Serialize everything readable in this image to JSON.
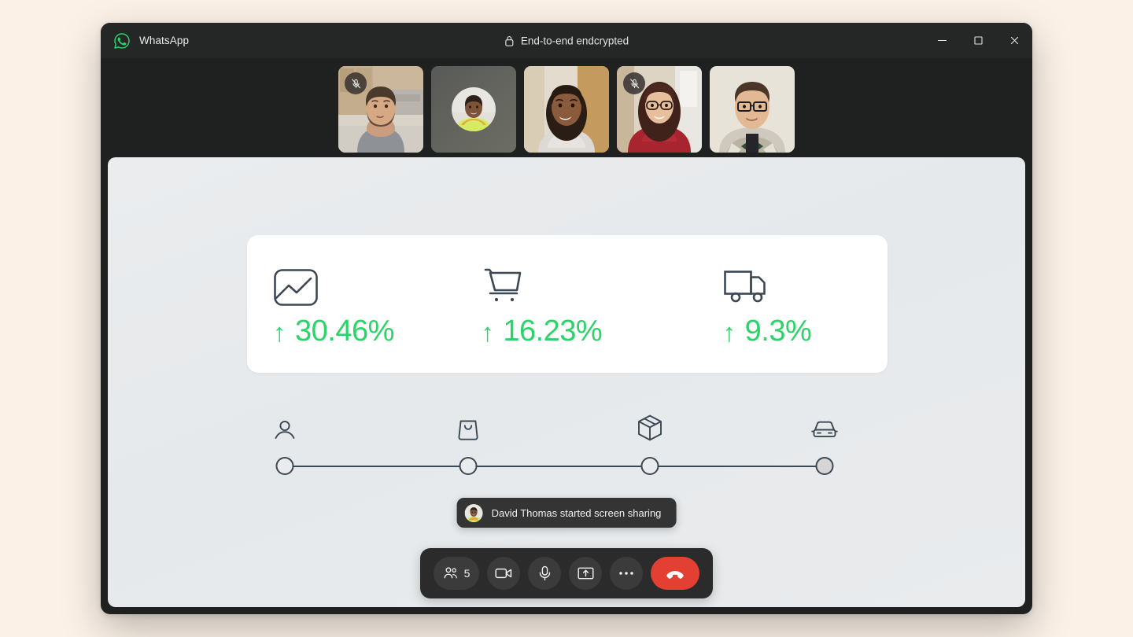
{
  "window": {
    "app_name": "WhatsApp",
    "logo_icon": "whatsapp-logo",
    "encryption_label": "End-to-end endcrypted",
    "lock_icon": "lock-icon",
    "controls": [
      {
        "name": "minimize",
        "icon": "minimize-icon"
      },
      {
        "name": "maximize",
        "icon": "maximize-icon"
      },
      {
        "name": "close",
        "icon": "close-icon"
      }
    ]
  },
  "call": {
    "participants": [
      {
        "name": "participant-1",
        "muted": true,
        "camera_on": true,
        "mute_icon": "mic-off-icon"
      },
      {
        "name": "participant-2",
        "muted": false,
        "camera_on": false,
        "mute_icon": ""
      },
      {
        "name": "participant-3",
        "muted": false,
        "camera_on": true,
        "mute_icon": ""
      },
      {
        "name": "participant-4",
        "muted": true,
        "camera_on": true,
        "mute_icon": "mic-off-icon"
      },
      {
        "name": "participant-5",
        "muted": false,
        "camera_on": true,
        "mute_icon": ""
      }
    ]
  },
  "shared_screen": {
    "metrics": [
      {
        "icon": "image-chart-icon",
        "arrow": "↑",
        "value": "30.46%"
      },
      {
        "icon": "shopping-cart-icon",
        "arrow": "↑",
        "value": "16.23%"
      },
      {
        "icon": "delivery-truck-icon",
        "arrow": "↑",
        "value": "9.3%"
      }
    ],
    "journey": {
      "steps": [
        {
          "icon": "user-icon",
          "filled": false,
          "position": 0
        },
        {
          "icon": "shopping-bag-icon",
          "filled": false,
          "position": 33.3
        },
        {
          "icon": "package-box-icon",
          "filled": false,
          "position": 66.6
        },
        {
          "icon": "car-icon",
          "filled": true,
          "position": 100
        }
      ]
    }
  },
  "toast": {
    "avatar_icon": "user-avatar",
    "message": "David Thomas started screen sharing"
  },
  "controls": {
    "participants": {
      "icon": "people-icon",
      "count": "5"
    },
    "camera": {
      "icon": "video-camera-icon"
    },
    "microphone": {
      "icon": "microphone-icon"
    },
    "share_screen": {
      "icon": "share-screen-icon"
    },
    "more": {
      "icon": "more-dots-icon"
    },
    "end_call": {
      "icon": "end-call-icon"
    }
  },
  "colors": {
    "page_background": "#fbf1e7",
    "window_background": "#1f2020",
    "titlebar": "#252626",
    "shared_screen": "#e8eaec",
    "accent_green": "#2ad468",
    "brand_green": "#25d366",
    "end_call_red": "#e33f33",
    "icon_dark": "#3c4854"
  }
}
